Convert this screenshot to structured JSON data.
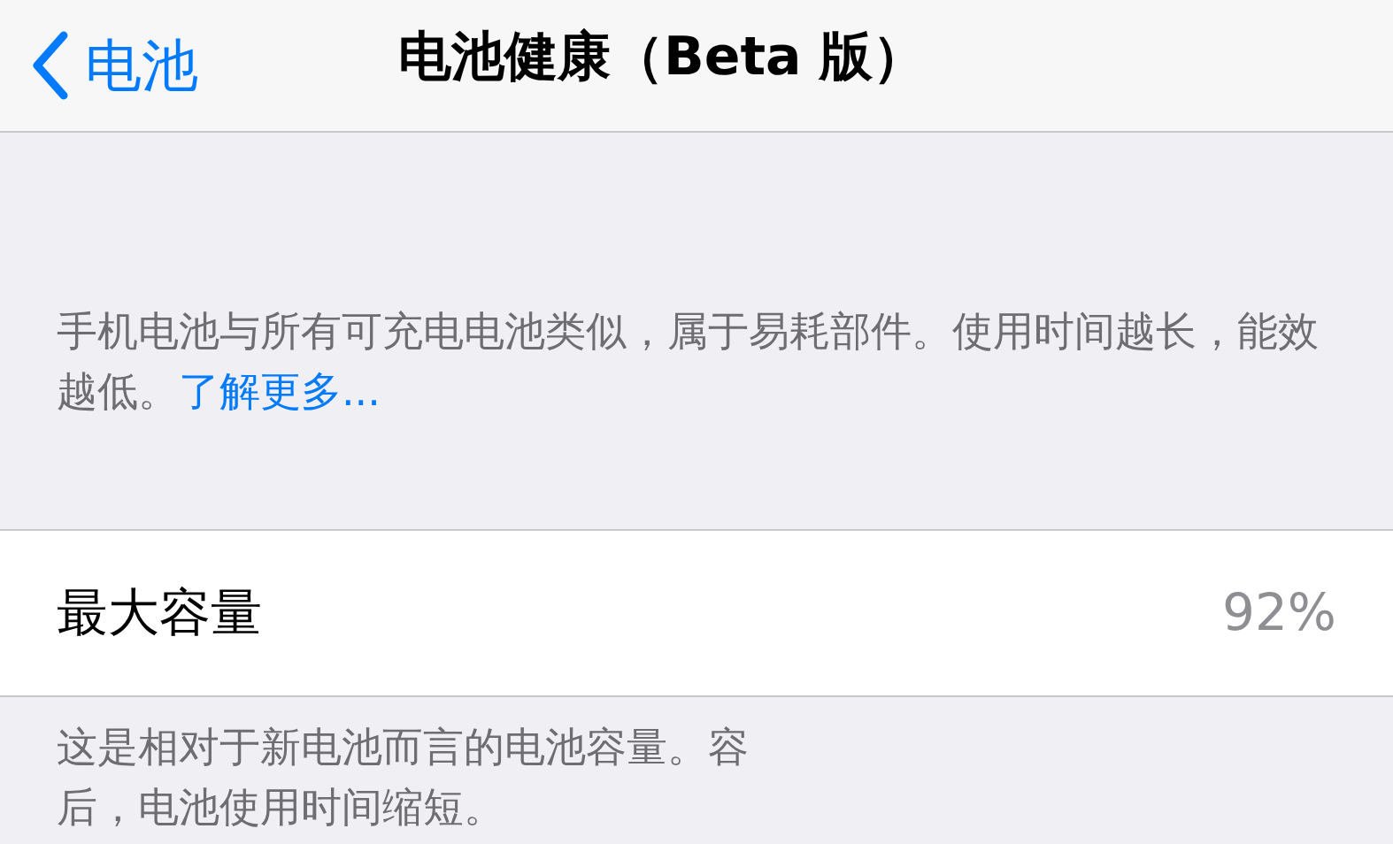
{
  "nav_bar": {
    "back_label": "电池",
    "title": "电池健康（Beta 版）"
  },
  "header_note": {
    "text": "手机电池与所有可充电电池类似，属于易耗部件。使用时间越长，能效越低。",
    "link": "了解更多..."
  },
  "rows": [
    {
      "label": "最大容量",
      "value": "92%"
    }
  ],
  "footer_note": {
    "lines": [
      "这是相对于新电池而言的电池容量。容",
      "后，电池使用时间缩短。"
    ]
  }
}
